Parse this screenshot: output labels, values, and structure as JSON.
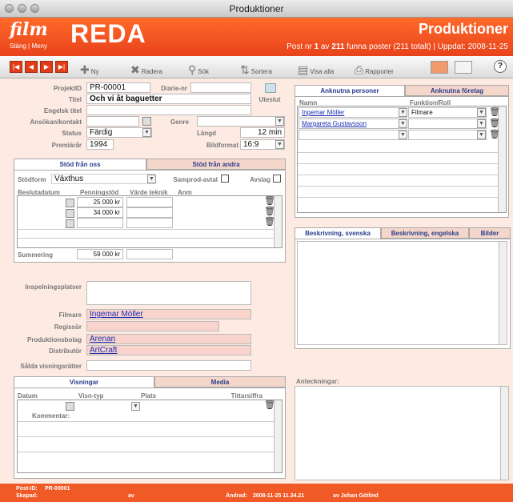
{
  "window": {
    "title": "Produktioner"
  },
  "header": {
    "brand_film": "film",
    "brand_reda": "REDA",
    "links": [
      "Stäng",
      "Meny"
    ],
    "title": "Produktioner",
    "info_pre": "Post nr ",
    "record_num": "1",
    "info_mid": " av ",
    "found_count": "211",
    "info_post": " funna poster (211 totalt) | Uppdat: 2008-11-25"
  },
  "toolbar": {
    "new_label": "Ny",
    "delete_label": "Radera",
    "search_label": "Sök",
    "sort_label": "Sortera",
    "show_all_label": "Visa alla",
    "reports_label": "Rapporter"
  },
  "form": {
    "projektid_label": "ProjektID",
    "projektid": "PR-00001",
    "diarienr_label": "Diarie-nr",
    "diarienr": "",
    "titel_label": "Titel",
    "titel": "Och vi åt baguetter",
    "engelsk_titel_label": "Engelsk titel",
    "engelsk_titel": "",
    "ansokan_label": "Ansökan/kontakt",
    "genre_label": "Genre",
    "status_label": "Status",
    "status": "Färdig",
    "langd_label": "Längd",
    "langd": "12 min",
    "premiarar_label": "Premiärår",
    "premiarar": "1994",
    "bildformat_label": "Bildformat",
    "bildformat": "16:9",
    "utesl_label": "Uteslut"
  },
  "stod": {
    "tabs": [
      "Stöd från oss",
      "Stöd från andra"
    ],
    "stodform_label": "Stödform",
    "stodform": "Växthus",
    "samprod_label": "Samprod-avtal",
    "avslag_label": "Avslag",
    "columns": [
      "Beslutadatum",
      "Penningstöd",
      "Värde teknik",
      "Anm"
    ],
    "rows": [
      {
        "amount": "25 000 kr"
      },
      {
        "amount": "34 000 kr"
      },
      {
        "amount": ""
      }
    ],
    "summering_label": "Summering",
    "summering": "59 000 kr"
  },
  "middle": {
    "inspelningsplatser_label": "Inspelningsplatser",
    "filmare_label": "Filmare",
    "filmare": "Ingemar Möller",
    "regissor_label": "Regissör",
    "produktionsbolag_label": "Produktionsbolag",
    "produktionsbolag": "Arenan",
    "distributor_label": "Distributör",
    "distributor": "ArtCraft",
    "salda_label": "Sålda visningsrätter"
  },
  "visningar": {
    "tabs": [
      "Visningar",
      "Media"
    ],
    "columns": [
      "Datum",
      "Visn-typ",
      "Plats",
      "Tittarsiffra"
    ],
    "kommentar_label": "Kommentar:"
  },
  "persons": {
    "tabs": [
      "Anknutna personer",
      "Anknutna företag"
    ],
    "columns": [
      "Namn",
      "Funktion/Roll"
    ],
    "rows": [
      {
        "name": "Ingemar Möller",
        "role": "Filmare"
      },
      {
        "name": "Margareta Gustavsson",
        "role": ""
      },
      {
        "name": "",
        "role": ""
      }
    ]
  },
  "description": {
    "tabs": [
      "Beskrivning, svenska",
      "Beskrivning, engelska",
      "Bilder"
    ]
  },
  "notes": {
    "label": "Anteckningar:"
  },
  "footer": {
    "post_id_label": "Post-ID:",
    "post_id": "PR-00001",
    "skapad_label": "Skapad:",
    "skapad_av": "av",
    "andrad_label": "Ändrad:",
    "andrad": "2008-11-25 11.34.21",
    "andrad_av": "av Johan Götlind"
  },
  "colors": {
    "accent": "#e8431b",
    "body_bg": "#fdebe3",
    "link": "#1a2cb3"
  }
}
